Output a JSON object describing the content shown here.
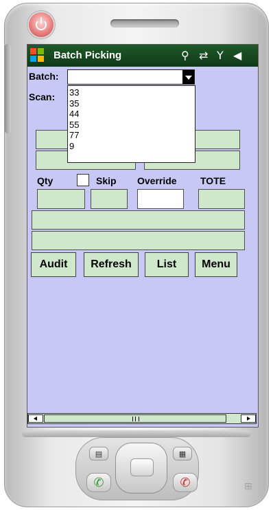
{
  "taskbar": {
    "title": "Batch Picking",
    "icons": [
      "connectivity-icon",
      "sync-icon",
      "signal-off-icon",
      "volume-icon"
    ]
  },
  "form": {
    "batch_label": "Batch:",
    "scan_label": "Scan:",
    "batch_value": "",
    "batch_options": [
      "33",
      "35",
      "44",
      "55",
      "77",
      "9"
    ],
    "qty_label": "Qty",
    "skip_label": "Skip",
    "override_label": "Override",
    "tote_label": "TOTE"
  },
  "buttons": {
    "audit": "Audit",
    "refresh": "Refresh",
    "list": "List",
    "menu": "Menu"
  },
  "colors": {
    "screen_bg": "#c8c8f4",
    "field_bg": "#cfe8cc",
    "taskbar_bg": "#1f5a2a"
  }
}
